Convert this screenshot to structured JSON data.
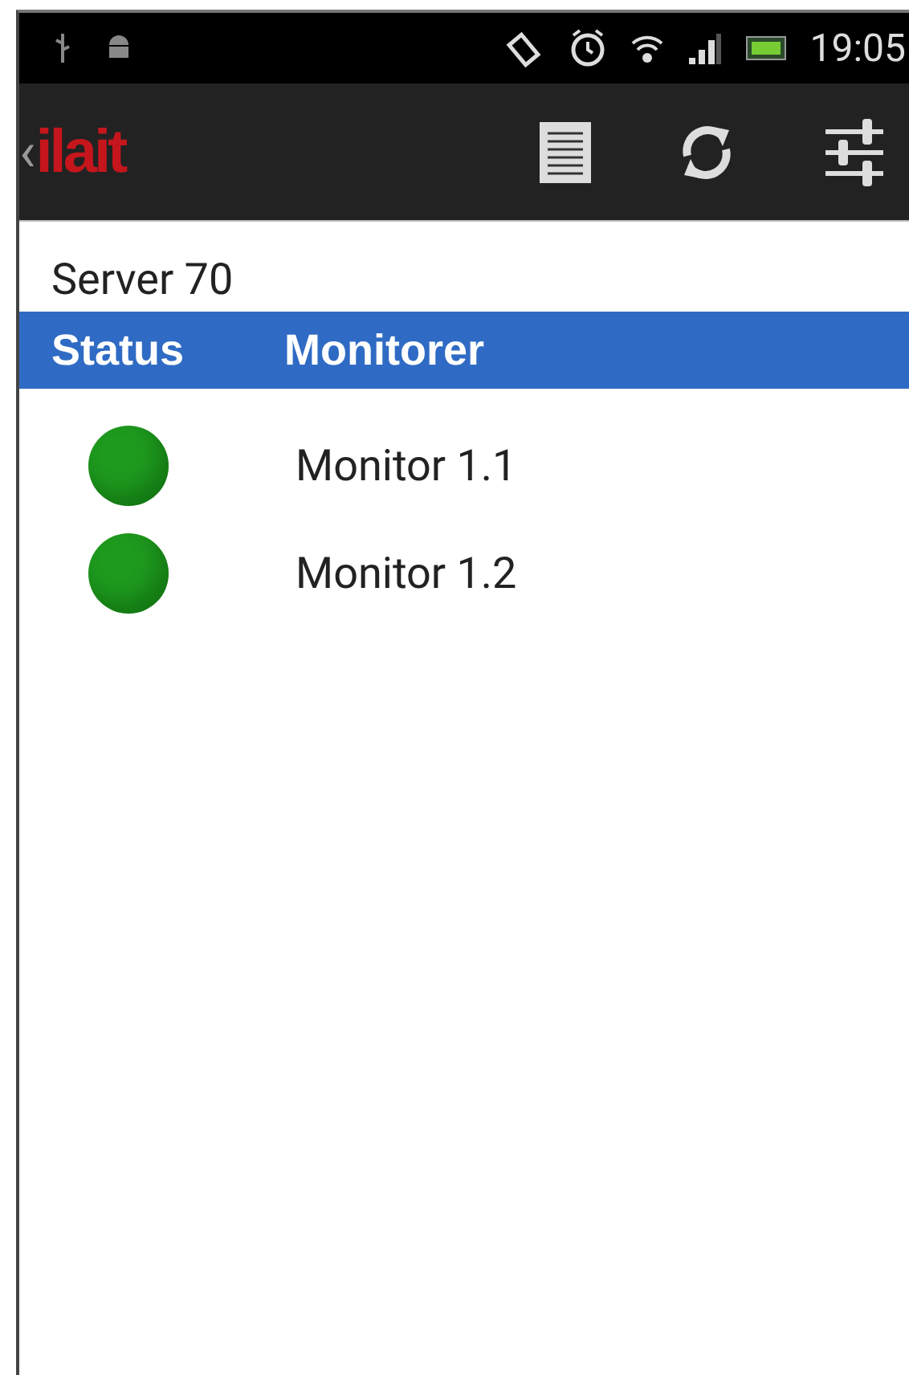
{
  "status_bar": {
    "time": "19:05"
  },
  "app_bar": {
    "back": "‹",
    "logo": "ilait"
  },
  "server": {
    "title": "Server 70"
  },
  "table": {
    "columns": [
      "Status",
      "Monitorer"
    ],
    "rows": [
      {
        "name": "Monitor 1.1",
        "color": "#1e9a1e"
      },
      {
        "name": "Monitor 1.2",
        "color": "#1e9a1e"
      }
    ]
  }
}
